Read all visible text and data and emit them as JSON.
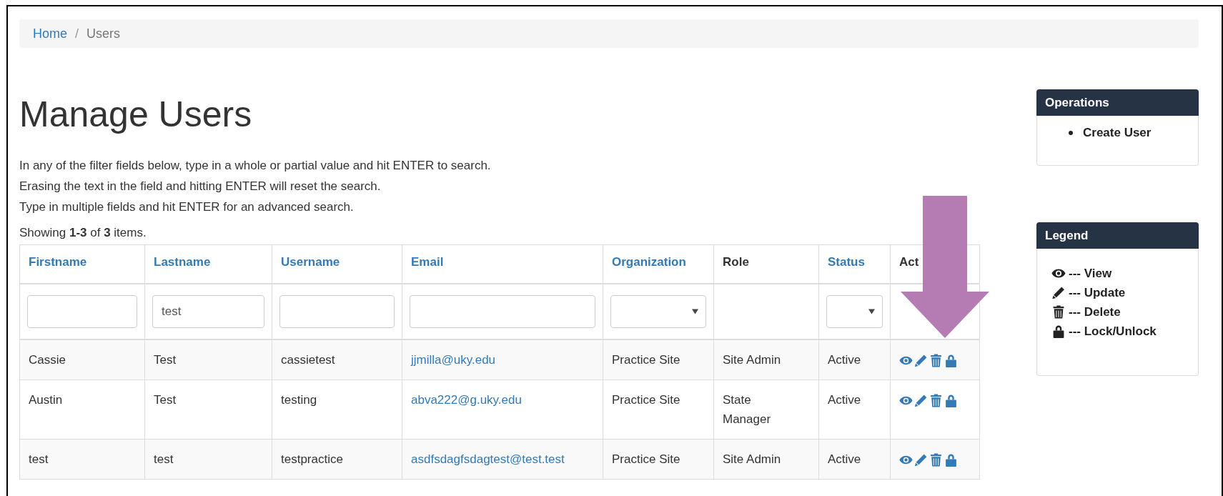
{
  "breadcrumb": [
    {
      "label": "Home",
      "kind": "link"
    },
    {
      "label": "/",
      "kind": "separator"
    },
    {
      "label": "Users",
      "kind": "current"
    }
  ],
  "heading": "Manage Users",
  "instructions": [
    "In any of the filter fields below, type in a whole or partial value and hit ENTER to search.",
    "Erasing the text in the field and hitting ENTER will reset the search.",
    "Type in multiple fields and hit ENTER for an advanced search."
  ],
  "summary": "Showing **1-3** of **3** items.",
  "table": {
    "columns": [
      {
        "label": "Firstname",
        "sortable": true
      },
      {
        "label": "Lastname",
        "sortable": true
      },
      {
        "label": "Username",
        "sortable": true
      },
      {
        "label": "Email",
        "sortable": true,
        "link_cells": true
      },
      {
        "label": "Organization",
        "sortable": true
      },
      {
        "label": "Role",
        "sortable": false
      },
      {
        "label": "Status",
        "sortable": true
      },
      {
        "label": "Act",
        "sortable": false
      }
    ],
    "filters": [
      {
        "kind": "text"
      },
      {
        "kind": "text",
        "value": "test"
      },
      {
        "kind": "text"
      },
      {
        "kind": "text"
      },
      {
        "kind": "select"
      },
      {
        "kind": "none"
      },
      {
        "kind": "select"
      },
      {
        "kind": "none"
      }
    ],
    "rows": [
      {
        "cells": [
          "Cassie",
          "Test",
          "cassietest",
          "jjmilla@uky.edu",
          "Practice Site",
          "Site Admin",
          "Active"
        ],
        "actions": [
          {
            "kind": "view"
          },
          {
            "kind": "update"
          },
          {
            "kind": "delete"
          },
          {
            "kind": "lock"
          }
        ]
      },
      {
        "cells": [
          "Austin",
          "Test",
          "testing",
          "abva222@g.uky.edu",
          "Practice Site",
          "State Manager",
          "Active"
        ],
        "actions": [
          {
            "kind": "view"
          },
          {
            "kind": "update"
          },
          {
            "kind": "delete"
          },
          {
            "kind": "lock"
          }
        ]
      },
      {
        "cells": [
          "test",
          "test",
          "testpractice",
          "asdfsdagfsdagtest@test.test",
          "Practice Site",
          "Site Admin",
          "Active"
        ],
        "actions": [
          {
            "kind": "view"
          },
          {
            "kind": "update"
          },
          {
            "kind": "delete"
          },
          {
            "kind": "lock"
          }
        ]
      }
    ]
  },
  "annotations": [
    {
      "kind": "down-arrow"
    }
  ],
  "operations": {
    "title": "Operations",
    "items": [
      "Create User"
    ]
  },
  "legend": {
    "title": "Legend",
    "items": [
      {
        "kind": "view",
        "label": "--- View"
      },
      {
        "kind": "update",
        "label": "--- Update"
      },
      {
        "kind": "delete",
        "label": "--- Delete"
      },
      {
        "kind": "lock",
        "label": "--- Lock/Unlock"
      }
    ]
  }
}
